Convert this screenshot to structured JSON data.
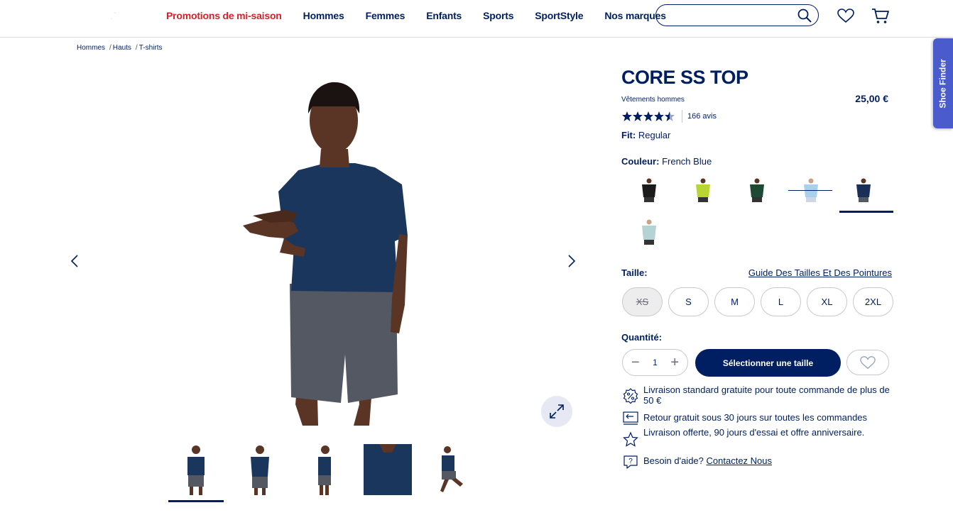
{
  "header": {
    "nav": [
      {
        "label": "Promotions de mi-saison"
      },
      {
        "label": "Hommes"
      },
      {
        "label": "Femmes"
      },
      {
        "label": "Enfants"
      },
      {
        "label": "Sports"
      },
      {
        "label": "SportStyle"
      },
      {
        "label": "Nos marques"
      }
    ],
    "search_placeholder": "",
    "icons": [
      "search-icon",
      "heart-icon",
      "cart-icon"
    ],
    "promo_color": "#d2232a"
  },
  "breadcrumb": [
    "Hommes",
    "Hauts",
    "T-shirts"
  ],
  "product": {
    "title": "CORE SS TOP",
    "category": "Vêtements hommes",
    "price": "25,00 €",
    "rating": 4.5,
    "reviews": "166 avis",
    "fit_label": "Fit:",
    "fit_value": "Regular",
    "color_label": "Couleur:",
    "color_value": "French Blue",
    "swatches": [
      {
        "color": "#1b1b1b",
        "selected": false,
        "out_of_stock": false
      },
      {
        "color": "#b9d534",
        "selected": false,
        "out_of_stock": false
      },
      {
        "color": "#1e4a33",
        "selected": false,
        "out_of_stock": false
      },
      {
        "color": "#a9d0ee",
        "selected": false,
        "out_of_stock": true
      },
      {
        "color": "#1a2f57",
        "selected": true,
        "out_of_stock": false
      },
      {
        "color": "#b5d2d4",
        "selected": false,
        "out_of_stock": false
      }
    ],
    "size_label": "Taille:",
    "size_guide": "Guide Des Tailles Et Des Pointures",
    "sizes": [
      {
        "label": "XS",
        "available": false
      },
      {
        "label": "S",
        "available": true
      },
      {
        "label": "M",
        "available": true
      },
      {
        "label": "L",
        "available": true
      },
      {
        "label": "XL",
        "available": true
      },
      {
        "label": "2XL",
        "available": true
      }
    ],
    "quantity_label": "Quantité:",
    "quantity": "1",
    "add_button": "Sélectionner une taille",
    "benefits": [
      {
        "icon": "percent-badge-icon",
        "text": "Livraison standard gratuite pour toute commande de plus de 50 €"
      },
      {
        "icon": "return-truck-icon",
        "text": "Retour gratuit sous 30 jours sur toutes les commandes"
      },
      {
        "icon": "star-badge-icon",
        "text": "Livraison offerte, 90 jours d'essai et offre anniversaire."
      }
    ],
    "help_text": "Besoin d'aide?",
    "help_link": "Contactez Nous"
  },
  "gallery": {
    "thumbnail_count": 5,
    "active_thumbnail": 1
  },
  "shoe_finder": "Shoe Finder",
  "colors": {
    "brand_navy": "#001e62",
    "accent_blue": "#4a5ccc",
    "shirt": "#1b365d",
    "shorts": "#545862",
    "skin": "#5a3424"
  }
}
